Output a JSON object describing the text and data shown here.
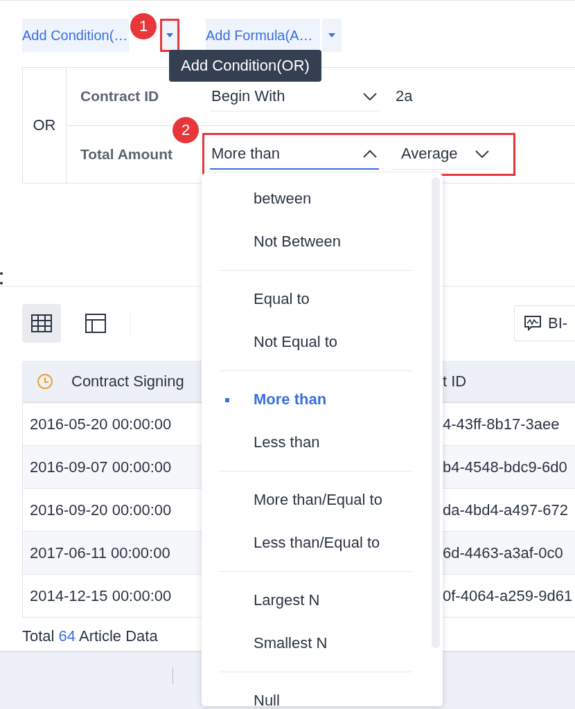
{
  "actions": [
    {
      "label": "Add Condition(…",
      "highlighted": true,
      "badge": "1"
    },
    {
      "label": "Add Formula(A…",
      "highlighted": false
    }
  ],
  "tooltip": "Add Condition(OR)",
  "filter": {
    "logic": "OR",
    "badge": "2",
    "rows": [
      {
        "field": "Contract ID",
        "operator": "Begin With",
        "expanded": false,
        "value": "2a",
        "highlighted": false
      },
      {
        "field": "Total Amount",
        "operator": "More than",
        "expanded": true,
        "value": "Average",
        "highlighted": true
      }
    ]
  },
  "view_tabs": [
    {
      "kind": "grid",
      "selected": true
    },
    {
      "kind": "layout",
      "selected": false
    }
  ],
  "bi_button": "BI-",
  "table": {
    "columns": [
      "Contract Signing ",
      "t ID"
    ],
    "rows": [
      [
        "2016-05-20 00:00:00",
        "4-43ff-8b17-3aee"
      ],
      [
        "2016-09-07 00:00:00",
        "b4-4548-bdc9-6d0"
      ],
      [
        "2016-09-20 00:00:00",
        "da-4bd4-a497-672"
      ],
      [
        "2017-06-11 00:00:00",
        "6d-4463-a3af-0c0"
      ],
      [
        "2014-12-15 00:00:00",
        "0f-4064-a259-9d61"
      ]
    ]
  },
  "footer": {
    "prefix": "Total",
    "count": "64",
    "suffix": "Article Data"
  },
  "dropdown": [
    [
      {
        "label": "between",
        "selected": false
      },
      {
        "label": "Not Between",
        "selected": false
      }
    ],
    [
      {
        "label": "Equal to",
        "selected": false
      },
      {
        "label": "Not Equal to",
        "selected": false
      }
    ],
    [
      {
        "label": "More than",
        "selected": true
      },
      {
        "label": "Less than",
        "selected": false
      }
    ],
    [
      {
        "label": "More than/Equal to",
        "selected": false
      },
      {
        "label": "Less than/Equal to",
        "selected": false
      }
    ],
    [
      {
        "label": "Largest N",
        "selected": false
      },
      {
        "label": "Smallest N",
        "selected": false
      }
    ],
    [
      {
        "label": "Null",
        "selected": false
      }
    ]
  ]
}
